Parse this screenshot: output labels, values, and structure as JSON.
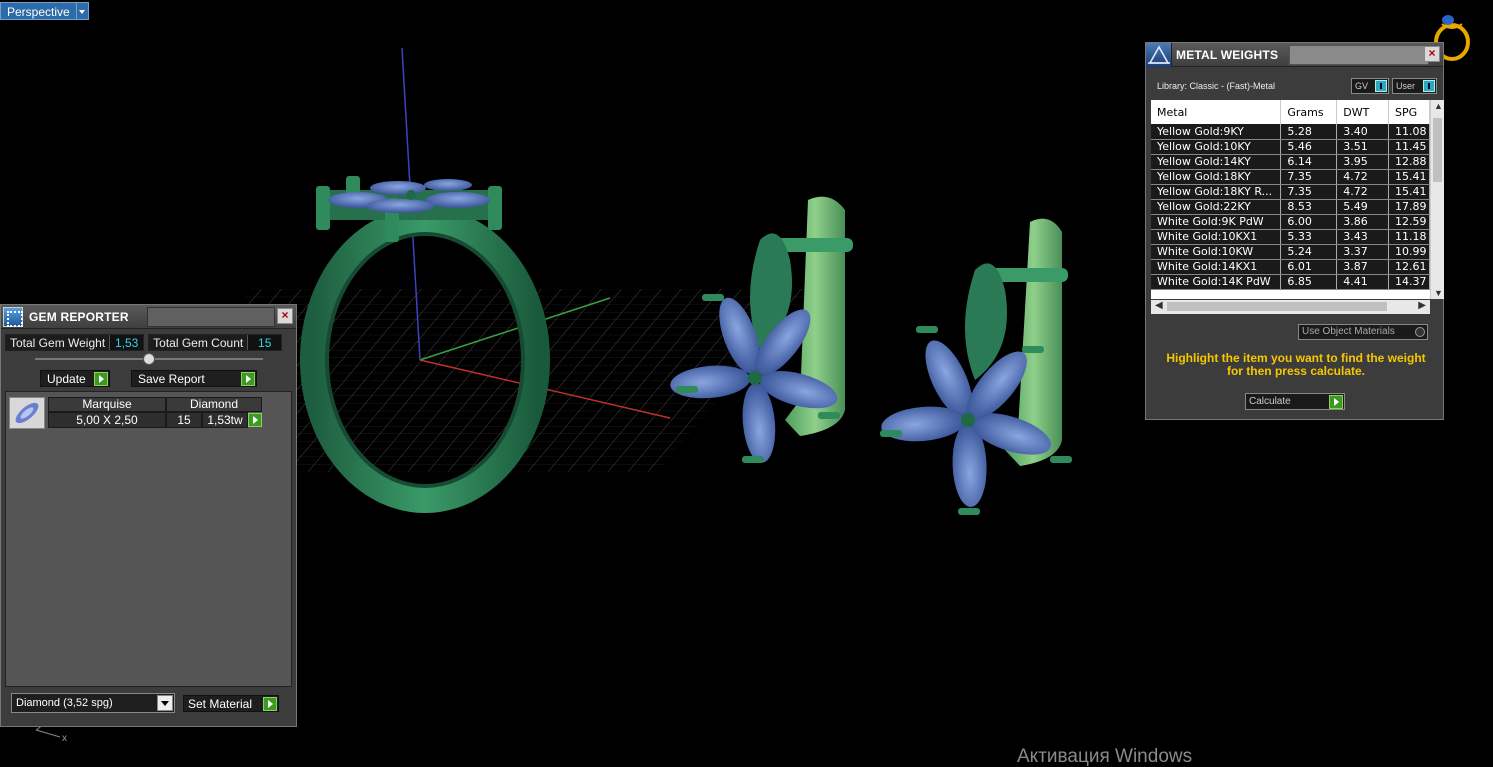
{
  "viewport": {
    "view_label": "Perspective",
    "axis_hint": "x",
    "watermark": "Активация Windows"
  },
  "gem_reporter": {
    "title": "GEM REPORTER",
    "total_weight_label": "Total Gem Weight",
    "total_weight_value": "1,53",
    "total_count_label": "Total Gem Count",
    "total_count_value": "15",
    "update_label": "Update",
    "save_report_label": "Save Report",
    "gems": [
      {
        "shape": "Marquise",
        "material": "Diamond",
        "size": "5,00 X 2,50",
        "count": "15",
        "weight": "1,53tw"
      }
    ],
    "material_select": "Diamond     (3,52 spg)",
    "set_material_label": "Set Material"
  },
  "metal_weights": {
    "title": "METAL WEIGHTS",
    "library": "Library: Classic - (Fast)-Metal",
    "unit_select_1": "GV",
    "unit_select_2": "User",
    "columns": [
      "Metal",
      "Grams",
      "DWT",
      "SPG"
    ],
    "rows": [
      [
        "Yellow Gold:9KY",
        "5.28",
        "3.40",
        "11.08"
      ],
      [
        "Yellow Gold:10KY",
        "5.46",
        "3.51",
        "11.45"
      ],
      [
        "Yellow Gold:14KY",
        "6.14",
        "3.95",
        "12.88"
      ],
      [
        "Yellow Gold:18KY",
        "7.35",
        "4.72",
        "15.41"
      ],
      [
        "Yellow Gold:18KY R...",
        "7.35",
        "4.72",
        "15.41"
      ],
      [
        "Yellow Gold:22KY",
        "8.53",
        "5.49",
        "17.89"
      ],
      [
        "White Gold:9K PdW",
        "6.00",
        "3.86",
        "12.59"
      ],
      [
        "White Gold:10KX1",
        "5.33",
        "3.43",
        "11.18"
      ],
      [
        "White Gold:10KW",
        "5.24",
        "3.37",
        "10.99"
      ],
      [
        "White Gold:14KX1",
        "6.01",
        "3.87",
        "12.61"
      ],
      [
        "White Gold:14K PdW",
        "6.85",
        "4.41",
        "14.37"
      ]
    ],
    "use_object_materials": "Use Object Materials",
    "hint": "Highlight the item you want to find the weight for then press calculate.",
    "calculate_label": "Calculate"
  },
  "colors": {
    "metal_green": "#2a7a55",
    "metal_green_light": "#6fbf7a",
    "gem_blue": "#4e6fb4",
    "hint_yellow": "#f5c800",
    "value_cyan": "#2fd6e8"
  }
}
